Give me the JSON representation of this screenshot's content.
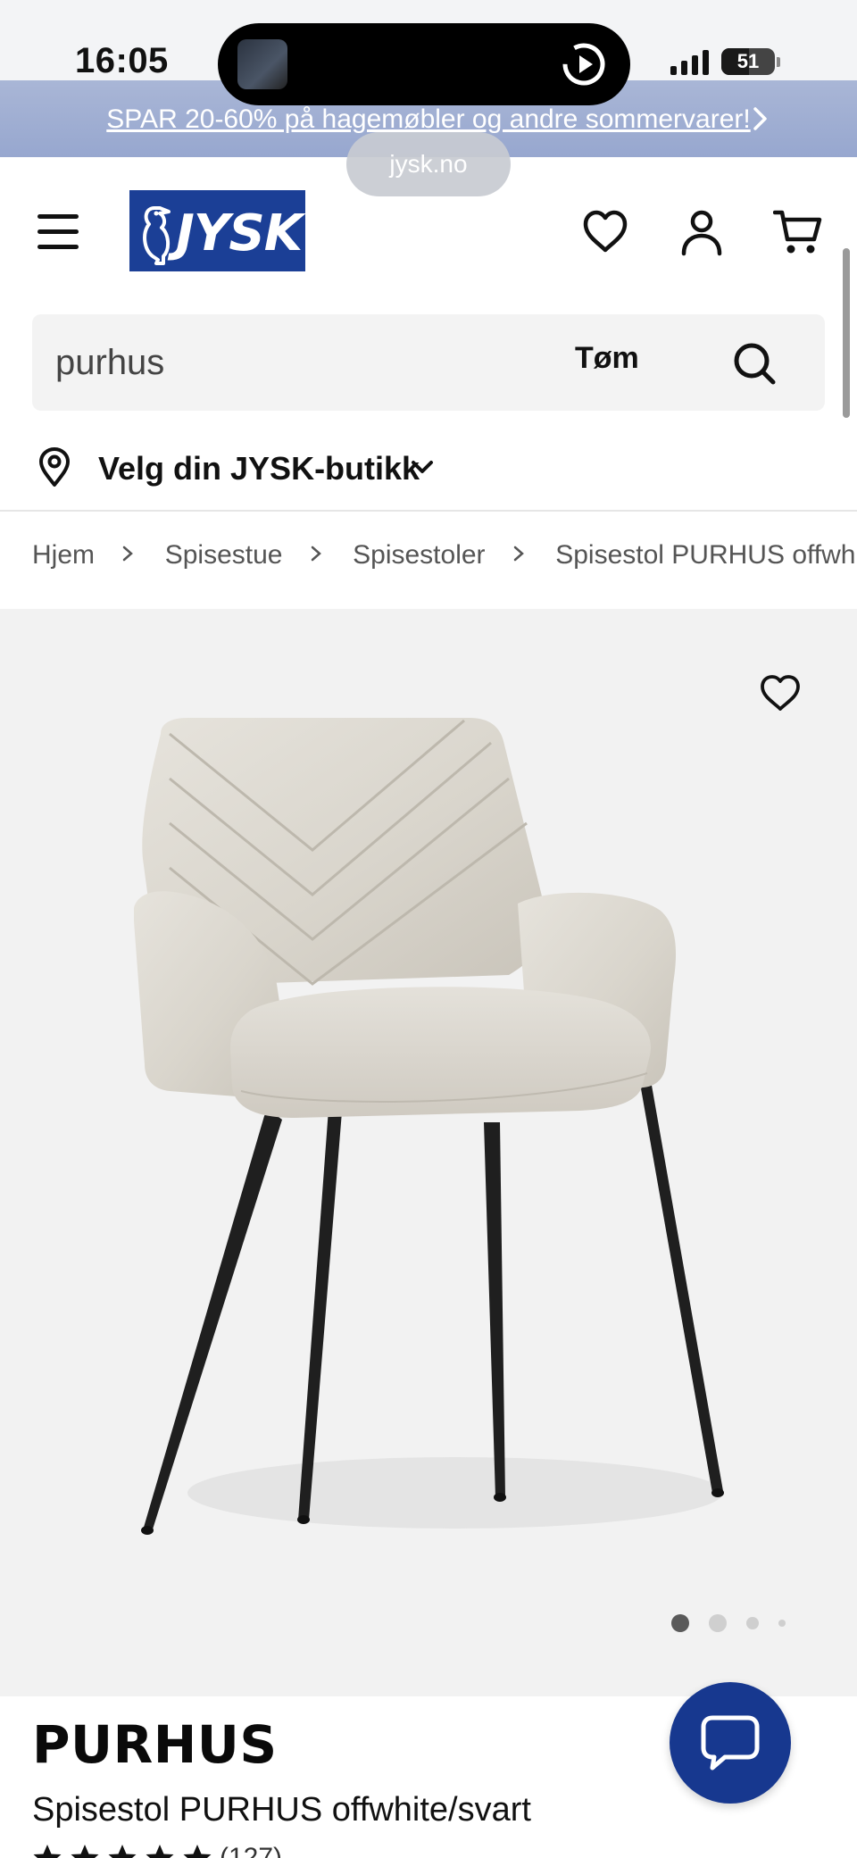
{
  "status_bar": {
    "time": "16:05",
    "battery": "51",
    "battery_level": 0.51
  },
  "promo": {
    "text": "SPAR 20-60% på hagemøbler og andre sommervarer!"
  },
  "browser": {
    "url": "jysk.no"
  },
  "header": {
    "logo_text": "JYSK"
  },
  "search": {
    "value": "purhus",
    "clear_label": "Tøm"
  },
  "store_selector": {
    "label": "Velg din JYSK-butikk"
  },
  "breadcrumb": [
    "Hjem",
    "Spisestue",
    "Spisestoler",
    "Spisestol PURHUS offwhite/"
  ],
  "gallery": {
    "image_count": 4,
    "active_index": 0
  },
  "product": {
    "name": "PURHUS",
    "description": "Spisestol PURHUS offwhite/svart",
    "rating_stars": 5,
    "review_count": "(127)"
  },
  "colors": {
    "brand": "#1b3f96",
    "promo": "#a2b0d3",
    "chat": "#17388f"
  }
}
